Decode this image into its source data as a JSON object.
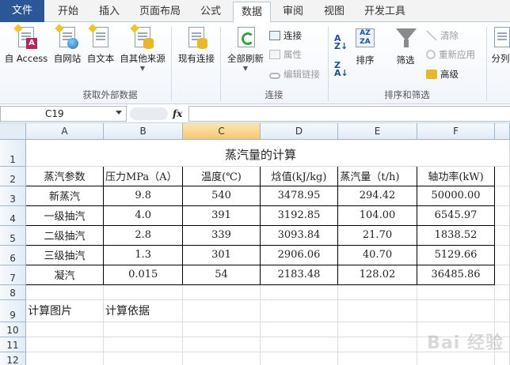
{
  "tabs": [
    "文件",
    "开始",
    "插入",
    "页面布局",
    "公式",
    "数据",
    "审阅",
    "视图",
    "开发工具"
  ],
  "ribbon": {
    "get_external": {
      "buttons": [
        "自 Access",
        "自网站",
        "自文本",
        "自其他来源",
        "现有连接"
      ],
      "group_label": "获取外部数据"
    },
    "connections": {
      "refresh_all": "全部刷新",
      "connect": "连接",
      "properties": "属性",
      "edit_links": "编辑链接",
      "group_label": "连接"
    },
    "sort_filter": {
      "sort": "排序",
      "filter": "筛选",
      "clear": "清除",
      "reapply": "重新应用",
      "advanced": "高级",
      "group_label": "排序和筛选"
    },
    "cut_off": "分列"
  },
  "formula_bar": {
    "name_box": "C19",
    "fx": "fx",
    "value": ""
  },
  "columns": [
    "A",
    "B",
    "C",
    "D",
    "E",
    "F"
  ],
  "selected_column": "C",
  "rows": [
    "1",
    "2",
    "3",
    "4",
    "5",
    "6",
    "7",
    "8",
    "9",
    "10",
    "11",
    "12"
  ],
  "sheet": {
    "title": "蒸汽量的计算",
    "headers": [
      "蒸汽参数",
      "压力MPa（A）",
      "温度(℃)",
      "焓值(kJ/kg)",
      "蒸汽量（t/h)",
      "轴功率(kW)"
    ],
    "data": [
      [
        "新蒸汽",
        "9.8",
        "540",
        "3478.95",
        "294.42",
        "50000.00"
      ],
      [
        "一级抽汽",
        "4.0",
        "391",
        "3192.85",
        "104.00",
        "6545.97"
      ],
      [
        "二级抽汽",
        "2.8",
        "339",
        "3093.84",
        "21.70",
        "1838.52"
      ],
      [
        "三级抽汽",
        "1.3",
        "301",
        "2906.06",
        "40.70",
        "5129.66"
      ],
      [
        "凝汽",
        "0.015",
        "54",
        "2183.48",
        "128.02",
        "36485.86"
      ]
    ],
    "row9": [
      "计算图片",
      "计算依据"
    ]
  },
  "watermark": "Bai 经验"
}
